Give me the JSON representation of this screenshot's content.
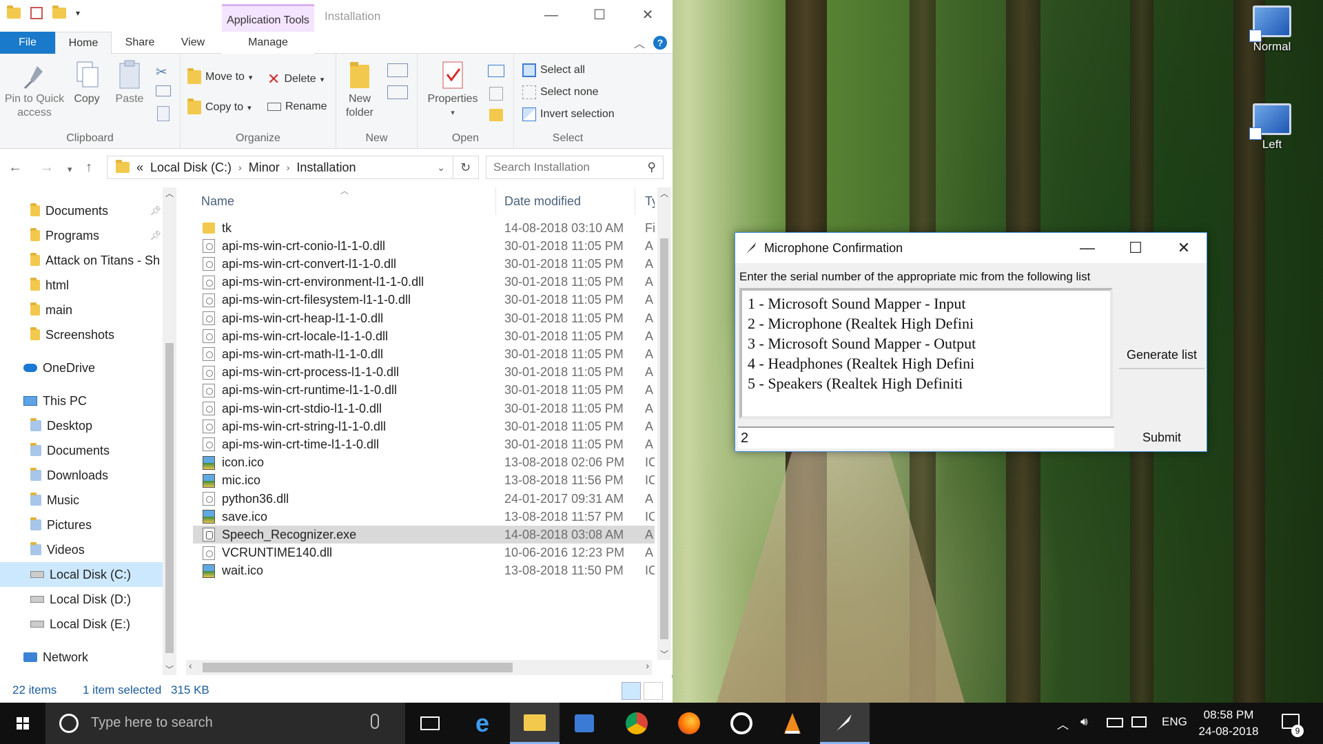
{
  "desktop": {
    "icons": [
      {
        "label": "Normal"
      },
      {
        "label": "Left"
      }
    ]
  },
  "explorer": {
    "window_title": "Installation",
    "context_tab": "Application Tools",
    "tabs": {
      "file": "File",
      "home": "Home",
      "share": "Share",
      "view": "View",
      "manage": "Manage"
    },
    "ribbon": {
      "clipboard": {
        "pin": "Pin to Quick access",
        "copy": "Copy",
        "paste": "Paste",
        "label": "Clipboard"
      },
      "organize": {
        "move_to": "Move to",
        "copy_to": "Copy to",
        "delete": "Delete",
        "rename": "Rename",
        "label": "Organize"
      },
      "new": {
        "new_folder": "New folder",
        "label": "New"
      },
      "open": {
        "properties": "Properties",
        "label": "Open"
      },
      "select": {
        "select_all": "Select all",
        "select_none": "Select none",
        "invert": "Invert selection",
        "label": "Select"
      }
    },
    "address": {
      "overflow": "«",
      "crumbs": [
        "Local Disk (C:)",
        "Minor",
        "Installation"
      ]
    },
    "search_placeholder": "Search Installation",
    "nav": [
      {
        "label": "Documents",
        "pinned": true
      },
      {
        "label": "Programs",
        "pinned": true
      },
      {
        "label": "Attack on Titans - Sh"
      },
      {
        "label": "html"
      },
      {
        "label": "main"
      },
      {
        "label": "Screenshots"
      },
      {
        "label": "OneDrive"
      },
      {
        "label": "This PC"
      },
      {
        "label": "Desktop"
      },
      {
        "label": "Documents"
      },
      {
        "label": "Downloads"
      },
      {
        "label": "Music"
      },
      {
        "label": "Pictures"
      },
      {
        "label": "Videos"
      },
      {
        "label": "Local Disk (C:)"
      },
      {
        "label": "Local Disk (D:)"
      },
      {
        "label": "Local Disk (E:)"
      },
      {
        "label": "Network"
      }
    ],
    "columns": {
      "name": "Name",
      "date": "Date modified",
      "type": "Ty"
    },
    "files": [
      {
        "name": "tk",
        "date": "14-08-2018 03:10 AM",
        "type": "Fi"
      },
      {
        "name": "api-ms-win-crt-conio-l1-1-0.dll",
        "date": "30-01-2018 11:05 PM",
        "type": "A"
      },
      {
        "name": "api-ms-win-crt-convert-l1-1-0.dll",
        "date": "30-01-2018 11:05 PM",
        "type": "A"
      },
      {
        "name": "api-ms-win-crt-environment-l1-1-0.dll",
        "date": "30-01-2018 11:05 PM",
        "type": "A"
      },
      {
        "name": "api-ms-win-crt-filesystem-l1-1-0.dll",
        "date": "30-01-2018 11:05 PM",
        "type": "A"
      },
      {
        "name": "api-ms-win-crt-heap-l1-1-0.dll",
        "date": "30-01-2018 11:05 PM",
        "type": "A"
      },
      {
        "name": "api-ms-win-crt-locale-l1-1-0.dll",
        "date": "30-01-2018 11:05 PM",
        "type": "A"
      },
      {
        "name": "api-ms-win-crt-math-l1-1-0.dll",
        "date": "30-01-2018 11:05 PM",
        "type": "A"
      },
      {
        "name": "api-ms-win-crt-process-l1-1-0.dll",
        "date": "30-01-2018 11:05 PM",
        "type": "A"
      },
      {
        "name": "api-ms-win-crt-runtime-l1-1-0.dll",
        "date": "30-01-2018 11:05 PM",
        "type": "A"
      },
      {
        "name": "api-ms-win-crt-stdio-l1-1-0.dll",
        "date": "30-01-2018 11:05 PM",
        "type": "A"
      },
      {
        "name": "api-ms-win-crt-string-l1-1-0.dll",
        "date": "30-01-2018 11:05 PM",
        "type": "A"
      },
      {
        "name": "api-ms-win-crt-time-l1-1-0.dll",
        "date": "30-01-2018 11:05 PM",
        "type": "A"
      },
      {
        "name": "icon.ico",
        "date": "13-08-2018 02:06 PM",
        "type": "IC"
      },
      {
        "name": "mic.ico",
        "date": "13-08-2018 11:56 PM",
        "type": "IC"
      },
      {
        "name": "python36.dll",
        "date": "24-01-2017 09:31 AM",
        "type": "A"
      },
      {
        "name": "save.ico",
        "date": "13-08-2018 11:57 PM",
        "type": "IC"
      },
      {
        "name": "Speech_Recognizer.exe",
        "date": "14-08-2018 03:08 AM",
        "type": "A"
      },
      {
        "name": "VCRUNTIME140.dll",
        "date": "10-06-2016 12:23 PM",
        "type": "A"
      },
      {
        "name": "wait.ico",
        "date": "13-08-2018 11:50 PM",
        "type": "IC"
      }
    ],
    "status": {
      "items": "22 items",
      "selected": "1 item selected",
      "size": "315 KB"
    }
  },
  "dialog": {
    "title": "Microphone Confirmation",
    "prompt": "Enter the serial number of the appropriate mic from the following list",
    "list": [
      "1 - Microsoft Sound Mapper - Input",
      "2 - Microphone (Realtek High Defini",
      "3 - Microsoft Sound Mapper - Output",
      "4 - Headphones (Realtek High Defini",
      "5 - Speakers (Realtek High Definiti"
    ],
    "generate_label": "Generate list",
    "entry_value": "2",
    "submit_label": "Submit"
  },
  "taskbar": {
    "search_placeholder": "Type here to search",
    "lang": "ENG",
    "time": "08:58 PM",
    "date": "24-08-2018",
    "notification_count": "9"
  }
}
